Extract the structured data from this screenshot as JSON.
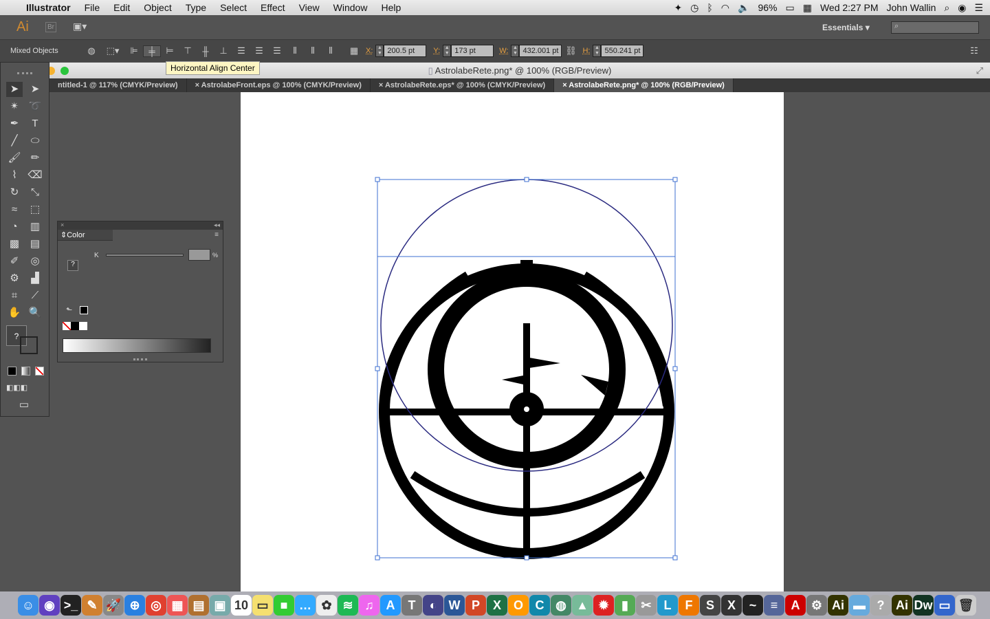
{
  "menubar": {
    "app": "Illustrator",
    "items": [
      "File",
      "Edit",
      "Object",
      "Type",
      "Select",
      "Effect",
      "View",
      "Window",
      "Help"
    ],
    "battery": "96%",
    "clock": "Wed 2:27 PM",
    "user": "John Wallin"
  },
  "appbar": {
    "logo": "Ai",
    "br": "Br",
    "workspace": "Essentials"
  },
  "control": {
    "selection": "Mixed Objects",
    "x_label": "X:",
    "x": "200.5 pt",
    "y_label": "Y:",
    "y": "173 pt",
    "w_label": "W:",
    "w": "432.001 pt",
    "h_label": "H:",
    "h": "550.241 pt"
  },
  "tooltip": "Horizontal Align Center",
  "document": {
    "title": "AstrolabeRete.png* @ 100% (RGB/Preview)",
    "tabs": [
      {
        "label": "ntitled-1 @ 117% (CMYK/Preview)",
        "active": false
      },
      {
        "label": "AstrolabeFront.eps @ 100% (CMYK/Preview)",
        "active": false
      },
      {
        "label": "AstrolabeRete.eps* @ 100% (CMYK/Preview)",
        "active": false
      },
      {
        "label": "AstrolabeRete.png* @ 100% (RGB/Preview)",
        "active": true
      }
    ]
  },
  "color_panel": {
    "title": "Color",
    "channel": "K",
    "percent": "%",
    "unknown": "?"
  },
  "colors": {
    "selection": "#3d6fd0",
    "accent_label": "#e8a040"
  },
  "dock": [
    {
      "icon": "finder",
      "c": "#3a8ee6",
      "g": "☺"
    },
    {
      "icon": "siri",
      "c": "#6040c0",
      "g": "◉"
    },
    {
      "icon": "terminal",
      "c": "#222",
      "g": ">_"
    },
    {
      "icon": "notes",
      "c": "#d08030",
      "g": "✎"
    },
    {
      "icon": "launchpad",
      "c": "#888",
      "g": "🚀"
    },
    {
      "icon": "safari",
      "c": "#2a80e0",
      "g": "⊕"
    },
    {
      "icon": "chrome",
      "c": "#e04030",
      "g": "◎"
    },
    {
      "icon": "calendar-app",
      "c": "#e55",
      "g": "▦"
    },
    {
      "icon": "books",
      "c": "#b07030",
      "g": "▤"
    },
    {
      "icon": "preview",
      "c": "#7aa",
      "g": "▣"
    },
    {
      "icon": "calendar",
      "c": "#fff",
      "g": "10"
    },
    {
      "icon": "stickies",
      "c": "#f5e070",
      "g": "▭"
    },
    {
      "icon": "facetime",
      "c": "#3c3",
      "g": "■"
    },
    {
      "icon": "messages",
      "c": "#3af",
      "g": "…"
    },
    {
      "icon": "photos",
      "c": "#eee",
      "g": "✿"
    },
    {
      "icon": "spotify",
      "c": "#1db954",
      "g": "≋"
    },
    {
      "icon": "itunes",
      "c": "#e6e",
      "g": "♫"
    },
    {
      "icon": "app-store",
      "c": "#29f",
      "g": "A"
    },
    {
      "icon": "tex",
      "c": "#777",
      "g": "T"
    },
    {
      "icon": "eclipse",
      "c": "#448",
      "g": "◐"
    },
    {
      "icon": "word",
      "c": "#2b5797",
      "g": "W"
    },
    {
      "icon": "powerpoint",
      "c": "#d24726",
      "g": "P"
    },
    {
      "icon": "excel",
      "c": "#1e7145",
      "g": "X"
    },
    {
      "icon": "openoffice",
      "c": "#f90",
      "g": "O"
    },
    {
      "icon": "c-app",
      "c": "#18a",
      "g": "C"
    },
    {
      "icon": "globe",
      "c": "#486",
      "g": "◍"
    },
    {
      "icon": "maps",
      "c": "#7b9",
      "g": "▲"
    },
    {
      "icon": "virus",
      "c": "#d22",
      "g": "✹"
    },
    {
      "icon": "evernote",
      "c": "#5a5",
      "g": "▮"
    },
    {
      "icon": "tools",
      "c": "#999",
      "g": "✂"
    },
    {
      "icon": "l-app",
      "c": "#29c",
      "g": "L"
    },
    {
      "icon": "f-app",
      "c": "#e70",
      "g": "F"
    },
    {
      "icon": "s-app",
      "c": "#444",
      "g": "S"
    },
    {
      "icon": "x11",
      "c": "#333",
      "g": "X"
    },
    {
      "icon": "activity",
      "c": "#222",
      "g": "~"
    },
    {
      "icon": "network",
      "c": "#569",
      "g": "≡"
    },
    {
      "icon": "acrobat",
      "c": "#c00",
      "g": "A"
    },
    {
      "icon": "settings",
      "c": "#777",
      "g": "⚙"
    },
    {
      "icon": "illustrator",
      "c": "#330",
      "g": "Ai"
    },
    {
      "icon": "folder",
      "c": "#6ad",
      "g": "▬"
    },
    {
      "icon": "help",
      "c": "#aaa",
      "g": "?"
    },
    {
      "icon": "illustrator-2",
      "c": "#330",
      "g": "Ai"
    },
    {
      "icon": "dreamweaver",
      "c": "#132",
      "g": "Dw"
    },
    {
      "icon": "display",
      "c": "#36c",
      "g": "▭"
    },
    {
      "icon": "trash",
      "c": "#ccc",
      "g": "🗑"
    }
  ]
}
